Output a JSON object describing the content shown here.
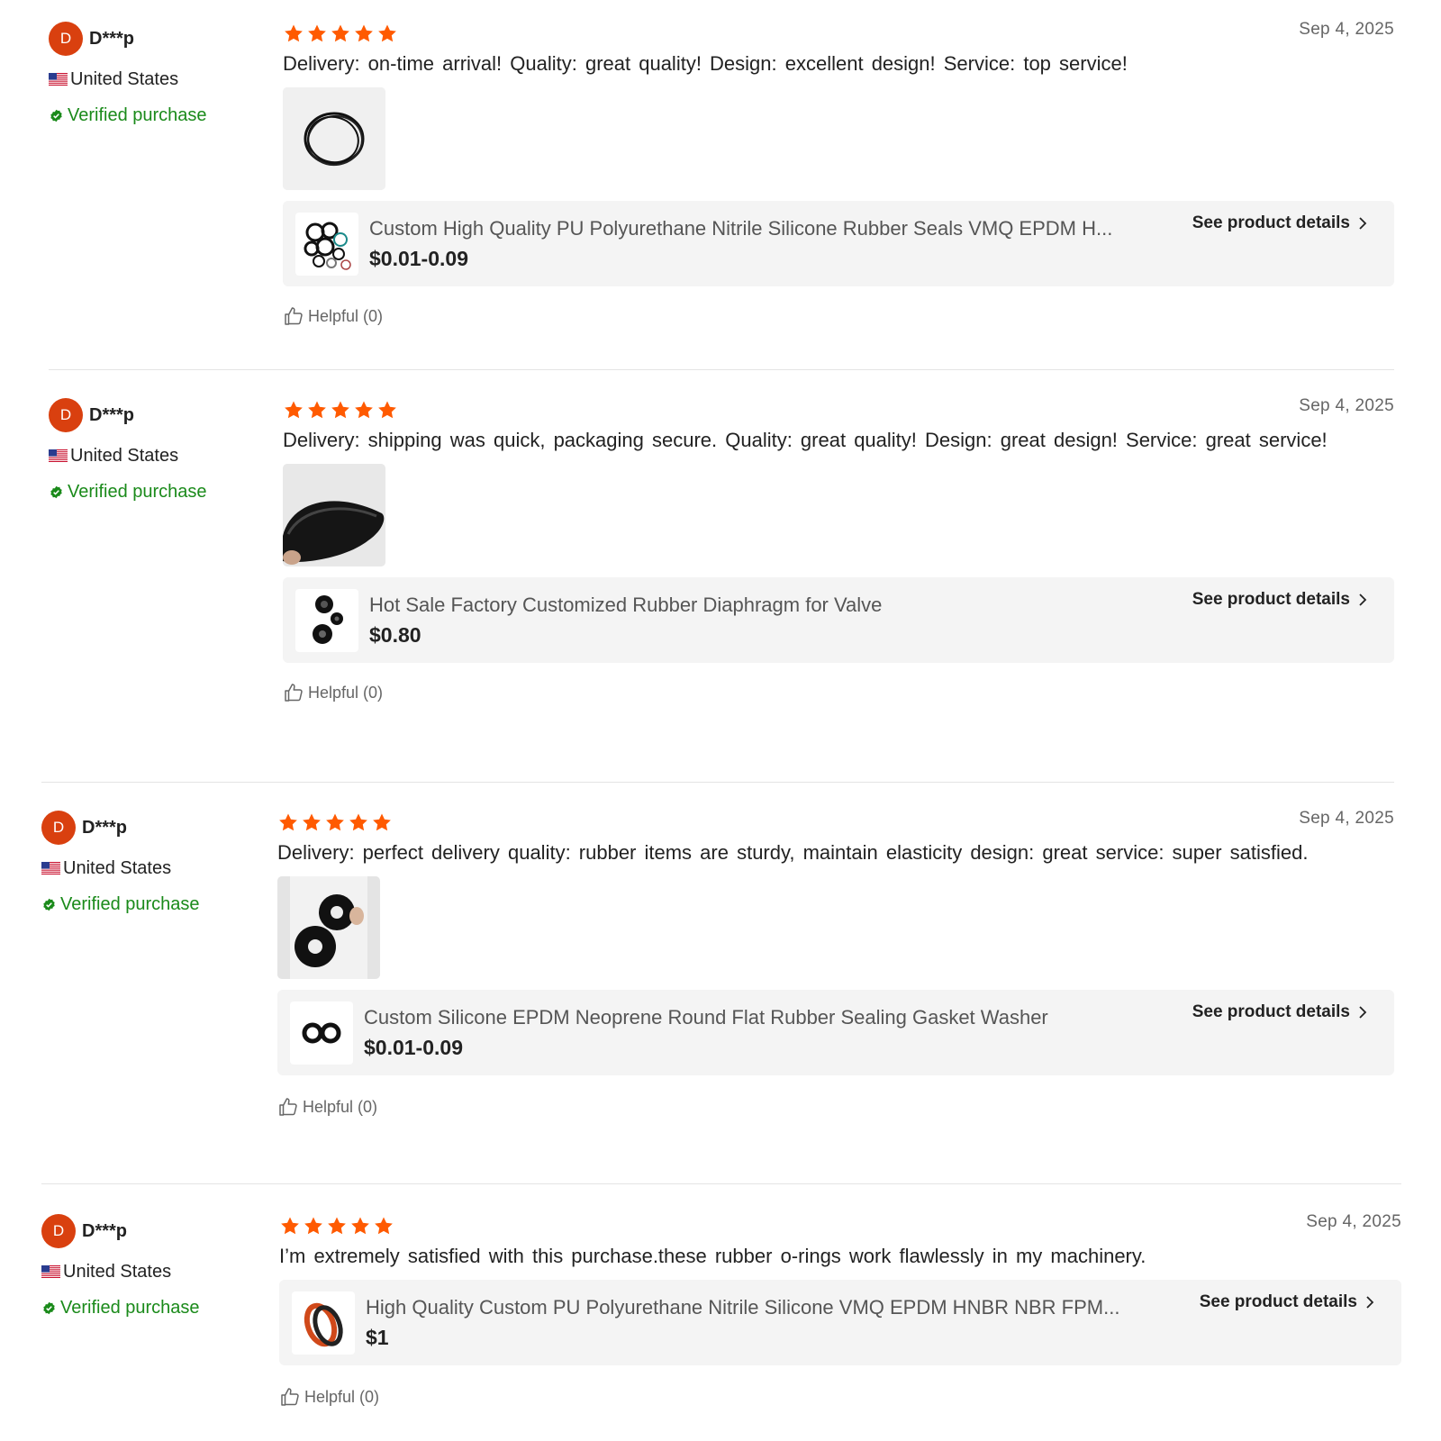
{
  "colors": {
    "avatar": "#d9400f",
    "star": "#ff5a00",
    "verified": "#1a8a1a",
    "card_bg": "#f4f4f4",
    "divider": "#e4e4e4"
  },
  "labels": {
    "see_details": "See product details",
    "helpful": "Helpful (0)",
    "verified": "Verified purchase"
  },
  "reviews": [
    {
      "avatar_letter": "D",
      "username": "D***p",
      "country": "United States",
      "verified": "Verified purchase",
      "rating": 5,
      "date": "Sep 4, 2025",
      "text": "Delivery:  on-time arrival!  Quality:  great quality! Design:  excellent design! Service:  top service!",
      "photo_icon": "o-ring-photo",
      "product": {
        "title": "Custom High Quality PU Polyurethane Nitrile Silicone Rubber Seals VMQ EPDM H...",
        "price": "$0.01-0.09",
        "thumb_icon": "o-ring-assortment-thumb"
      },
      "see_details": "See product details",
      "helpful": "Helpful (0)"
    },
    {
      "avatar_letter": "D",
      "username": "D***p",
      "country": "United States",
      "verified": "Verified purchase",
      "rating": 5,
      "date": "Sep 4, 2025",
      "text": "Delivery:  shipping was quick, packaging secure.  Quality:  great quality! Design:  great design!  Service:  great service!",
      "photo_icon": "diaphragm-photo",
      "product": {
        "title": "Hot Sale Factory Customized Rubber Diaphragm for Valve",
        "price": "$0.80",
        "thumb_icon": "diaphragm-thumb"
      },
      "see_details": "See product details",
      "helpful": "Helpful (0)"
    },
    {
      "avatar_letter": "D",
      "username": "D***p",
      "country": "United States",
      "verified": "Verified purchase",
      "rating": 5,
      "date": "Sep 4, 2025",
      "text": "Delivery:  perfect delivery quality:  rubber items are sturdy, maintain elasticity design:  great service:  super satisfied.",
      "photo_icon": "washer-photo",
      "product": {
        "title": "Custom Silicone EPDM Neoprene Round Flat Rubber Sealing Gasket Washer",
        "price": "$0.01-0.09",
        "thumb_icon": "washer-thumb"
      },
      "see_details": "See product details",
      "helpful": "Helpful (0)"
    },
    {
      "avatar_letter": "D",
      "username": "D***p",
      "country": "United States",
      "verified": "Verified purchase",
      "rating": 5,
      "date": "Sep 4, 2025",
      "text": "I’m extremely satisfied with this purchase.these rubber o-rings work flawlessly in my machinery.",
      "product": {
        "title": "High Quality Custom PU Polyurethane Nitrile Silicone VMQ EPDM HNBR NBR FPM...",
        "price": "$1",
        "thumb_icon": "seal-ring-thumb"
      },
      "see_details": "See product details",
      "helpful": "Helpful (0)"
    }
  ]
}
